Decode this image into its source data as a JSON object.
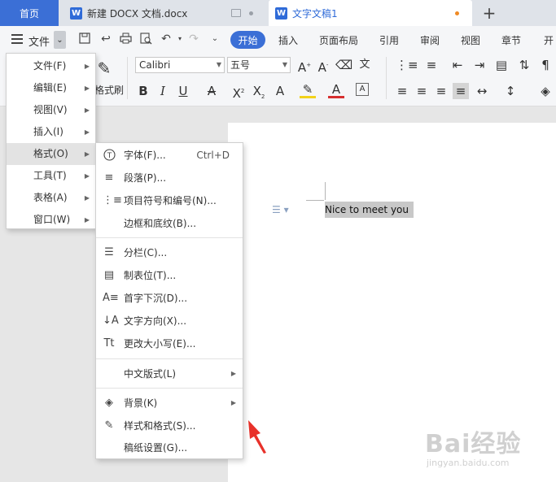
{
  "tabs": {
    "home": "首页",
    "doc1": "新建 DOCX 文档.docx",
    "doc2": "文字文稿1",
    "doc_icon": "W",
    "add": "+"
  },
  "ribbon": {
    "file": "文件",
    "tabs": [
      "开始",
      "插入",
      "页面布局",
      "引用",
      "审阅",
      "视图",
      "章节",
      "开"
    ],
    "font_name": "Calibri",
    "font_size": "五号",
    "format_brush": "格式刷"
  },
  "main_menu": {
    "items": [
      {
        "label": "文件(F)"
      },
      {
        "label": "编辑(E)"
      },
      {
        "label": "视图(V)"
      },
      {
        "label": "插入(I)"
      },
      {
        "label": "格式(O)"
      },
      {
        "label": "工具(T)"
      },
      {
        "label": "表格(A)"
      },
      {
        "label": "窗口(W)"
      }
    ]
  },
  "format_menu": {
    "items": [
      {
        "label": "字体(F)...",
        "shortcut": "Ctrl+D",
        "icon": "font-icon"
      },
      {
        "label": "段落(P)...",
        "icon": "paragraph-icon"
      },
      {
        "label": "项目符号和编号(N)...",
        "icon": "bullet-list-icon"
      },
      {
        "label": "边框和底纹(B)..."
      },
      {
        "label": "分栏(C)...",
        "icon": "columns-icon"
      },
      {
        "label": "制表位(T)...",
        "icon": "tab-stop-icon"
      },
      {
        "label": "首字下沉(D)...",
        "icon": "drop-cap-icon"
      },
      {
        "label": "文字方向(X)...",
        "icon": "text-direction-icon"
      },
      {
        "label": "更改大小写(E)...",
        "icon": "change-case-icon"
      },
      {
        "label": "中文版式(L)"
      },
      {
        "label": "背景(K)",
        "icon": "paint-bucket-icon"
      },
      {
        "label": "样式和格式(S)...",
        "icon": "styles-icon"
      },
      {
        "label": "稿纸设置(G)..."
      }
    ]
  },
  "document": {
    "selected_text": "Nice to meet you"
  },
  "watermark": {
    "brand": "Bai经验",
    "url": "jingyan.baidu.com"
  },
  "colors": {
    "accent": "#3b6fd6",
    "modified_dot": "#f08a24",
    "arrow": "#e8312a"
  }
}
